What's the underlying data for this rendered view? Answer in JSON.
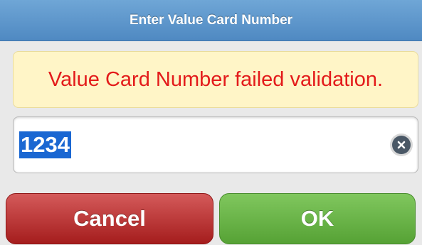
{
  "dialog": {
    "title": "Enter Value Card Number"
  },
  "error": {
    "message": "Value Card Number failed validation."
  },
  "input": {
    "value": "1234",
    "clear_icon": "clear-icon"
  },
  "buttons": {
    "cancel_label": "Cancel",
    "ok_label": "OK"
  },
  "colors": {
    "title_bar": "#5b95cb",
    "error_text": "#e31b1b",
    "error_background": "#fff5c7",
    "selection": "#1a67d2",
    "cancel_button": "#bb3333",
    "ok_button": "#68b346"
  }
}
